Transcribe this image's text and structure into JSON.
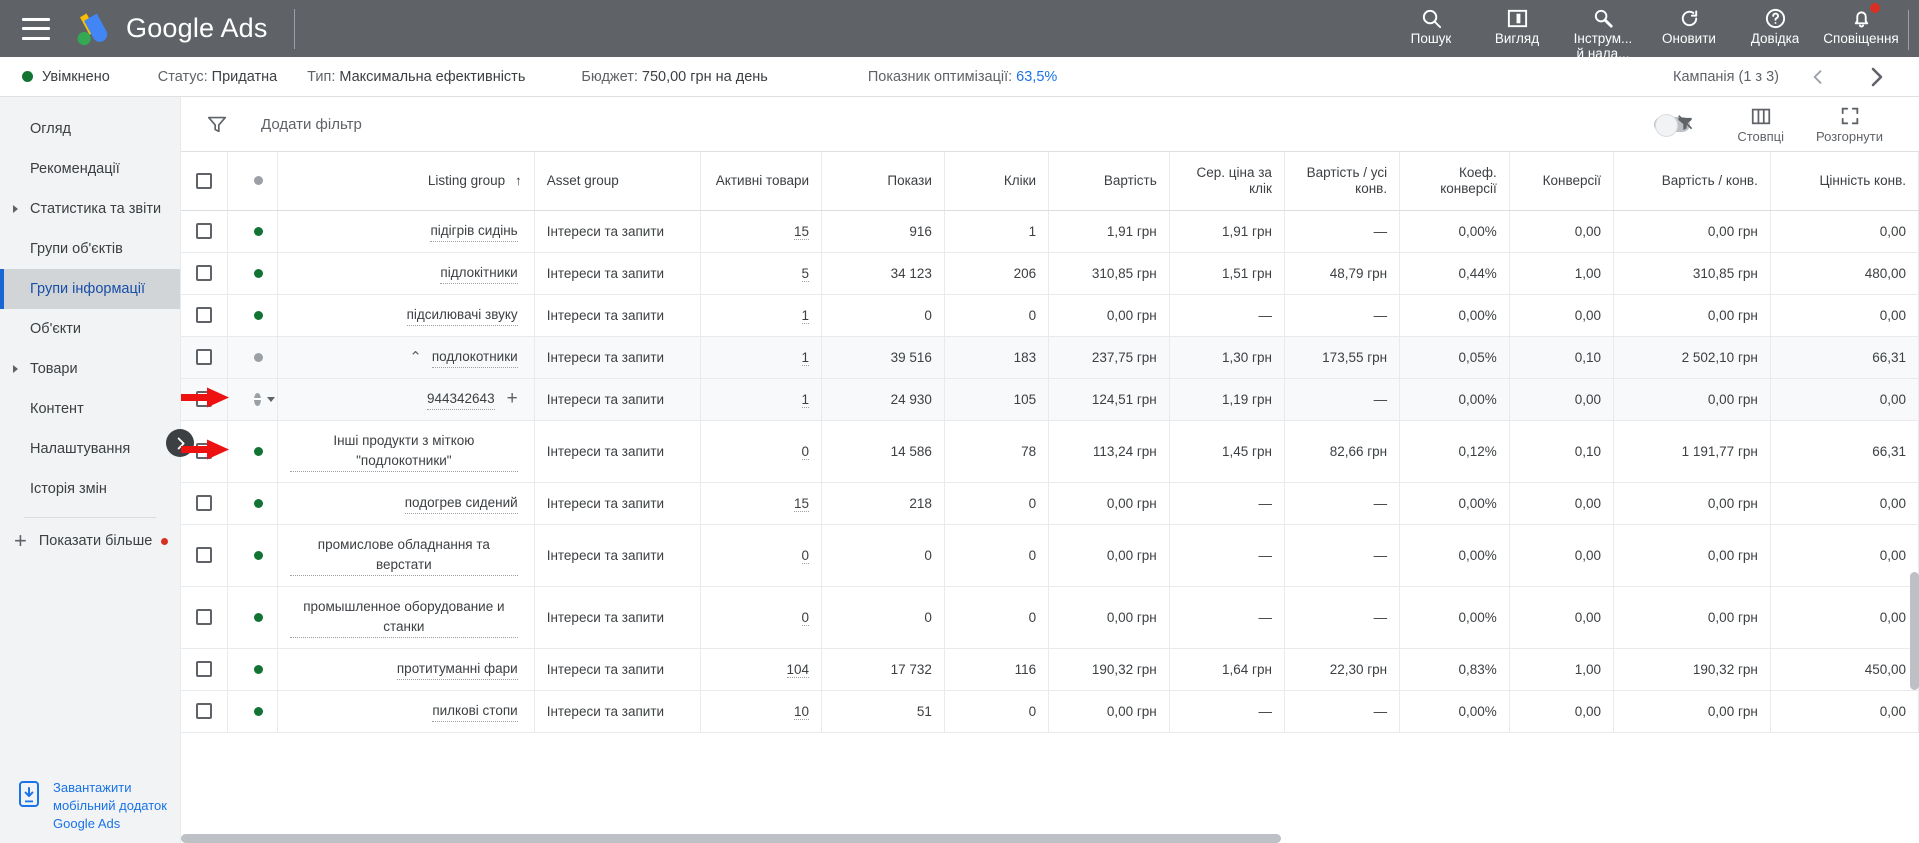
{
  "topbar": {
    "menu_icon": "hamburger-menu-icon",
    "brand": "Google Ads",
    "actions": [
      {
        "icon": "search-icon",
        "label": "Пошук",
        "label2": ""
      },
      {
        "icon": "view-icon",
        "label": "Вигляд",
        "label2": ""
      },
      {
        "icon": "tools-icon",
        "label": "Інструм...",
        "label2": "й нала..."
      },
      {
        "icon": "refresh-icon",
        "label": "Оновити",
        "label2": ""
      },
      {
        "icon": "help-icon",
        "label": "Довідка",
        "label2": ""
      },
      {
        "icon": "bell-icon",
        "label": "Сповіщення",
        "label2": ""
      }
    ]
  },
  "statusbar": {
    "enabled_label": "Увімкнено",
    "status_key": "Статус:",
    "status_value": "Придатна",
    "type_key": "Тип:",
    "type_value": "Максимальна ефективність",
    "budget_key": "Бюджет:",
    "budget_value": "750,00 грн на день",
    "optscore_key": "Показник оптимізації:",
    "optscore_value": "63,5%",
    "campaign_nav": "Кампанія (1 з 3)",
    "prev_icon": "chevron-left-icon",
    "next_icon": "chevron-right-icon",
    "accent": "#1a73e8",
    "enabled_color": "#137333"
  },
  "sidebar": {
    "items": [
      {
        "label": "Огляд",
        "expandable": false,
        "active": false,
        "badge": false
      },
      {
        "label": "Рекомендації",
        "expandable": false,
        "active": false,
        "badge": false
      },
      {
        "label": "Статистика та звіти",
        "expandable": true,
        "active": false,
        "badge": false
      },
      {
        "label": "Групи об'єктів",
        "expandable": false,
        "active": false,
        "badge": false
      },
      {
        "label": "Групи інформації",
        "expandable": false,
        "active": true,
        "badge": false
      },
      {
        "label": "Об'єкти",
        "expandable": false,
        "active": false,
        "badge": false
      },
      {
        "label": "Товари",
        "expandable": true,
        "active": false,
        "badge": false
      },
      {
        "label": "Контент",
        "expandable": false,
        "active": false,
        "badge": false
      },
      {
        "label": "Налаштування",
        "expandable": false,
        "active": false,
        "badge": false
      },
      {
        "label": "Історія змін",
        "expandable": false,
        "active": false,
        "badge": false
      }
    ],
    "show_more": "Показати більше",
    "footer_link": "Завантажити мобільний додаток Google Ads",
    "footer_icon": "mobile-download-icon",
    "collapse_icon": "chevron-right-icon"
  },
  "toolbar": {
    "filter_icon": "filter-icon",
    "add_filter": "Додати фільтр",
    "toggle_icon": "chart-toggle-icon",
    "columns_icon": "columns-icon",
    "columns_label": "Стовпці",
    "expand_icon": "fullscreen-icon",
    "expand_label": "Розгорнути"
  },
  "table": {
    "columns": [
      {
        "key": "checkbox",
        "label": ""
      },
      {
        "key": "state",
        "label": ""
      },
      {
        "key": "listing_group",
        "label": "Listing group",
        "sort": "↑"
      },
      {
        "key": "asset_group",
        "label": "Asset group"
      },
      {
        "key": "active_items",
        "label": "Активні товари"
      },
      {
        "key": "impressions",
        "label": "Покази"
      },
      {
        "key": "clicks",
        "label": "Кліки"
      },
      {
        "key": "cost",
        "label": "Вартість"
      },
      {
        "key": "avg_cpc",
        "label": "Сер. ціна за клік"
      },
      {
        "key": "cost_all_conv",
        "label": "Вартість / усі конв."
      },
      {
        "key": "conv_rate",
        "label": "Коеф. конверсії"
      },
      {
        "key": "conversions",
        "label": "Конверсії"
      },
      {
        "key": "cost_per_conv",
        "label": "Вартість / конв."
      },
      {
        "key": "conv_value",
        "label": "Цінність конв."
      }
    ],
    "rows": [
      {
        "state": "green",
        "name": "підігрів сидінь",
        "asset_group": "Інтереси та запити",
        "active_items": "15",
        "impressions": "916",
        "clicks": "1",
        "cost": "1,91 грн",
        "avg_cpc": "1,91 грн",
        "cost_all_conv": "—",
        "conv_rate": "0,00%",
        "conversions": "0,00",
        "cost_per_conv": "0,00 грн",
        "conv_value": "0,00",
        "shaded": false,
        "arrow": false,
        "expander": "",
        "plus": false,
        "caret": false,
        "checkbox": true
      },
      {
        "state": "green",
        "name": "підлокітники",
        "asset_group": "Інтереси та запити",
        "active_items": "5",
        "impressions": "34 123",
        "clicks": "206",
        "cost": "310,85 грн",
        "avg_cpc": "1,51 грн",
        "cost_all_conv": "48,79 грн",
        "conv_rate": "0,44%",
        "conversions": "1,00",
        "cost_per_conv": "310,85 грн",
        "conv_value": "480,00",
        "shaded": false,
        "arrow": false,
        "expander": "",
        "plus": false,
        "caret": false,
        "checkbox": true
      },
      {
        "state": "green",
        "name": "підсилювачі звуку",
        "asset_group": "Інтереси та запити",
        "active_items": "1",
        "impressions": "0",
        "clicks": "0",
        "cost": "0,00 грн",
        "avg_cpc": "—",
        "cost_all_conv": "—",
        "conv_rate": "0,00%",
        "conversions": "0,00",
        "cost_per_conv": "0,00 грн",
        "conv_value": "0,00",
        "shaded": false,
        "arrow": false,
        "expander": "",
        "plus": false,
        "caret": false,
        "checkbox": true
      },
      {
        "state": "grey",
        "name": "подлокотники",
        "asset_group": "Інтереси та запити",
        "active_items": "1",
        "impressions": "39 516",
        "clicks": "183",
        "cost": "237,75 грн",
        "avg_cpc": "1,30 грн",
        "cost_all_conv": "173,55 грн",
        "conv_rate": "0,05%",
        "conversions": "0,10",
        "cost_per_conv": "2 502,10 грн",
        "conv_value": "66,31",
        "shaded": true,
        "arrow": false,
        "expander": "⌃",
        "plus": false,
        "caret": false,
        "checkbox": true
      },
      {
        "state": "minus",
        "name": "944342643",
        "asset_group": "Інтереси та запити",
        "active_items": "1",
        "impressions": "24 930",
        "clicks": "105",
        "cost": "124,51 грн",
        "avg_cpc": "1,19 грн",
        "cost_all_conv": "—",
        "conv_rate": "0,00%",
        "conversions": "0,00",
        "cost_per_conv": "0,00 грн",
        "conv_value": "0,00",
        "shaded": true,
        "arrow": true,
        "expander": "",
        "plus": true,
        "caret": true,
        "checkbox": true
      },
      {
        "state": "green",
        "name": "Інші продукти з міткою \"подлокотники\"",
        "asset_group": "Інтереси та запити",
        "active_items": "0",
        "impressions": "14 586",
        "clicks": "78",
        "cost": "113,24 грн",
        "avg_cpc": "1,45 грн",
        "cost_all_conv": "82,66 грн",
        "conv_rate": "0,12%",
        "conversions": "0,10",
        "cost_per_conv": "1 191,77 грн",
        "conv_value": "66,31",
        "shaded": false,
        "arrow": true,
        "expander": "",
        "plus": false,
        "caret": false,
        "checkbox": true
      },
      {
        "state": "green",
        "name": "подогрев сидений",
        "asset_group": "Інтереси та запити",
        "active_items": "15",
        "impressions": "218",
        "clicks": "0",
        "cost": "0,00 грн",
        "avg_cpc": "—",
        "cost_all_conv": "—",
        "conv_rate": "0,00%",
        "conversions": "0,00",
        "cost_per_conv": "0,00 грн",
        "conv_value": "0,00",
        "shaded": false,
        "arrow": false,
        "expander": "",
        "plus": false,
        "caret": false,
        "checkbox": true
      },
      {
        "state": "green",
        "name": "промислове обладнання та верстати",
        "asset_group": "Інтереси та запити",
        "active_items": "0",
        "impressions": "0",
        "clicks": "0",
        "cost": "0,00 грн",
        "avg_cpc": "—",
        "cost_all_conv": "—",
        "conv_rate": "0,00%",
        "conversions": "0,00",
        "cost_per_conv": "0,00 грн",
        "conv_value": "0,00",
        "shaded": false,
        "arrow": false,
        "expander": "",
        "plus": false,
        "caret": false,
        "checkbox": true
      },
      {
        "state": "green",
        "name": "промышленное оборудование и станки",
        "asset_group": "Інтереси та запити",
        "active_items": "0",
        "impressions": "0",
        "clicks": "0",
        "cost": "0,00 грн",
        "avg_cpc": "—",
        "cost_all_conv": "—",
        "conv_rate": "0,00%",
        "conversions": "0,00",
        "cost_per_conv": "0,00 грн",
        "conv_value": "0,00",
        "shaded": false,
        "arrow": false,
        "expander": "",
        "plus": false,
        "caret": false,
        "checkbox": true
      },
      {
        "state": "green",
        "name": "протитуманні фари",
        "asset_group": "Інтереси та запити",
        "active_items": "104",
        "impressions": "17 732",
        "clicks": "116",
        "cost": "190,32 грн",
        "avg_cpc": "1,64 грн",
        "cost_all_conv": "22,30 грн",
        "conv_rate": "0,83%",
        "conversions": "1,00",
        "cost_per_conv": "190,32 грн",
        "conv_value": "450,00",
        "shaded": false,
        "arrow": false,
        "expander": "",
        "plus": false,
        "caret": false,
        "checkbox": true
      },
      {
        "state": "green",
        "name": "пилкові стопи",
        "asset_group": "Інтереси та запити",
        "active_items": "10",
        "impressions": "51",
        "clicks": "0",
        "cost": "0,00 грн",
        "avg_cpc": "—",
        "cost_all_conv": "—",
        "conv_rate": "0,00%",
        "conversions": "0,00",
        "cost_per_conv": "0,00 грн",
        "conv_value": "0,00",
        "shaded": false,
        "arrow": false,
        "expander": "",
        "plus": false,
        "caret": false,
        "checkbox": true
      }
    ]
  }
}
